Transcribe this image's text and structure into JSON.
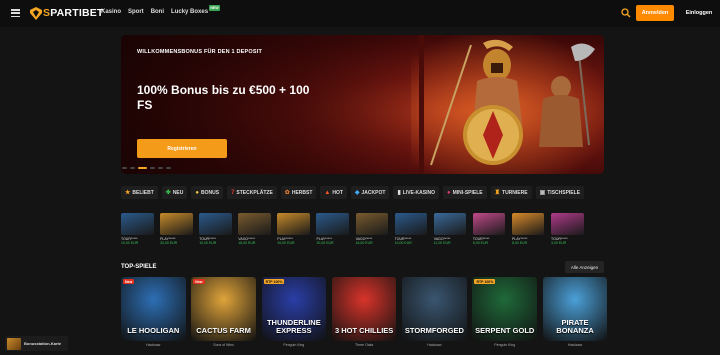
{
  "header": {
    "logo_prefix": "S",
    "logo_brand": "PARTIBET",
    "nav": [
      {
        "label": "Kasino"
      },
      {
        "label": "Sport"
      },
      {
        "label": "Boni"
      },
      {
        "label": "Lucky Boxes",
        "badge": "NEW"
      }
    ],
    "register_label": "Anmelden",
    "login_label": "Einloggen"
  },
  "hero": {
    "subtitle": "WILLKOMMENSBONUS FÜR DEN 1 DEPOSIT",
    "title": "100% Bonus bis zu €500 + 100 FS",
    "button_label": "Registrieren",
    "slides_total": 6,
    "active_slide": 2
  },
  "categories": [
    {
      "label": "BELIEBT",
      "icon": "star-icon",
      "glyph": "★",
      "color": "#f5a623"
    },
    {
      "label": "NEU",
      "icon": "clover-icon",
      "glyph": "✤",
      "color": "#3bbf4a"
    },
    {
      "label": "BONUS",
      "icon": "coin-icon",
      "glyph": "●",
      "color": "#f5c842"
    },
    {
      "label": "STECKPLÄTZE",
      "icon": "seven-icon",
      "glyph": "7",
      "color": "#e03a2e"
    },
    {
      "label": "HERBST",
      "icon": "leaf-icon",
      "glyph": "✿",
      "color": "#e07a2e"
    },
    {
      "label": "HOT",
      "icon": "fire-icon",
      "glyph": "▲",
      "color": "#ff5a1e"
    },
    {
      "label": "JACKPOT",
      "icon": "diamond-icon",
      "glyph": "◆",
      "color": "#3fa9f5"
    },
    {
      "label": "LIVE-KASINO",
      "icon": "cards-icon",
      "glyph": "▮",
      "color": "#dddddd"
    },
    {
      "label": "MINI-SPIELE",
      "icon": "bomb-icon",
      "glyph": "●",
      "color": "#e03a6e"
    },
    {
      "label": "TURNIERE",
      "icon": "trophy-icon",
      "glyph": "♜",
      "color": "#f5a623"
    },
    {
      "label": "TISCHSPIELE",
      "icon": "table-icon",
      "glyph": "▣",
      "color": "#bbbbbb"
    }
  ],
  "recent_wins": [
    {
      "name": "TOUR*****",
      "amount": "10,00 EUR",
      "color": "#2b5a8c"
    },
    {
      "name": "PLAY*****",
      "amount": "20,00 EUR",
      "color": "#c68b2a"
    },
    {
      "name": "TOUR*****",
      "amount": "10,00 EUR",
      "color": "#2b5a8c"
    },
    {
      "name": "VAGO*****",
      "amount": "16,00 EUR",
      "color": "#7a5b2e"
    },
    {
      "name": "PLAY*****",
      "amount": "20,00 EUR",
      "color": "#c68b2a"
    },
    {
      "name": "PLAY*****",
      "amount": "20,00 EUR",
      "color": "#2b5a8c"
    },
    {
      "name": "VAGO*****",
      "amount": "16,00 EUR",
      "color": "#7a5b2e"
    },
    {
      "name": "TOUR*****",
      "amount": "10,00 EUR",
      "color": "#2b5a8c"
    },
    {
      "name": "VAGO*****",
      "amount": "11,00 EUR",
      "color": "#3a6a9a"
    },
    {
      "name": "TOUR*****",
      "amount": "5,00 EUR",
      "color": "#c04a8a"
    },
    {
      "name": "PLAY*****",
      "amount": "8,00 EUR",
      "color": "#d88a2a"
    },
    {
      "name": "TOUR*****",
      "amount": "3,00 EUR",
      "color": "#b03a8a"
    }
  ],
  "top_games": {
    "title": "TOP-SPIELE",
    "show_all_label": "Alle Anzeigen",
    "items": [
      {
        "title": "LE HOOLIGAN",
        "provider": "Hacksaw",
        "badge": "New",
        "badge_type": "new",
        "bg": "#2d6fb5"
      },
      {
        "title": "CACTUS FARM",
        "provider": "Sons of Wins",
        "badge": "New",
        "badge_type": "new",
        "bg": "#e0a43a"
      },
      {
        "title": "THUNDERLINE EXPRESS",
        "provider": "Penguin King",
        "badge": "RTP 100%",
        "badge_type": "rtp",
        "bg": "#2a3ea8"
      },
      {
        "title": "3 HOT CHILLIES",
        "provider": "Three Oaks",
        "badge": "",
        "badge_type": "",
        "bg": "#d8342a"
      },
      {
        "title": "STORMFORGED",
        "provider": "Hacksaw",
        "badge": "",
        "badge_type": "",
        "bg": "#3a5670"
      },
      {
        "title": "SERPENT GOLD",
        "provider": "Penguin King",
        "badge": "RTP 100%",
        "badge_type": "rtp",
        "bg": "#1f6a3a"
      },
      {
        "title": "PIRATE BONANZA",
        "provider": "Hacksaw",
        "badge": "",
        "badge_type": "",
        "bg": "#4ba0d8"
      }
    ]
  },
  "bonus_card_label": "Bonusstation-Karte",
  "accent_color": "#f5a623"
}
